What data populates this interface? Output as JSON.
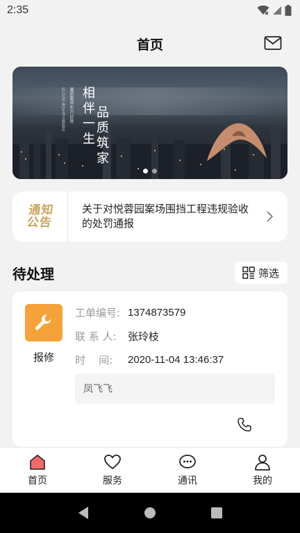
{
  "status_bar": {
    "time": "2:35"
  },
  "header": {
    "title": "首页",
    "mail_icon": "mail-icon"
  },
  "banner": {
    "line1": "相伴一生",
    "line2": "品质筑家",
    "small_a": "康桥集团 实力·好房",
    "small_b": "匠心打造·美好生活·品质服务",
    "dots": 2,
    "active_dot": 1
  },
  "notice": {
    "logo_line1": "通知",
    "logo_line2": "公告",
    "text": "关于对悦蓉园案场围挡工程违规验收的处罚通报"
  },
  "section": {
    "title": "待处理",
    "filter_label": "筛选"
  },
  "task": {
    "type": "报修",
    "order_label": "工单编号:",
    "order_value": "1374873579",
    "contact_label": "联 系 人:",
    "contact_value": "张玲枝",
    "time_label": "时    间:",
    "time_value": "2020-11-04 13:46:37",
    "note": "凤飞飞"
  },
  "tabs": [
    {
      "label": "首页",
      "icon": "home-icon",
      "active": true
    },
    {
      "label": "服务",
      "icon": "heart-icon",
      "active": false
    },
    {
      "label": "通讯",
      "icon": "chat-icon",
      "active": false
    },
    {
      "label": "我的",
      "icon": "user-icon",
      "active": false
    }
  ],
  "colors": {
    "accent": "#f6a23a",
    "home_active": "#f06a6a",
    "gold": "#c9a45d"
  }
}
